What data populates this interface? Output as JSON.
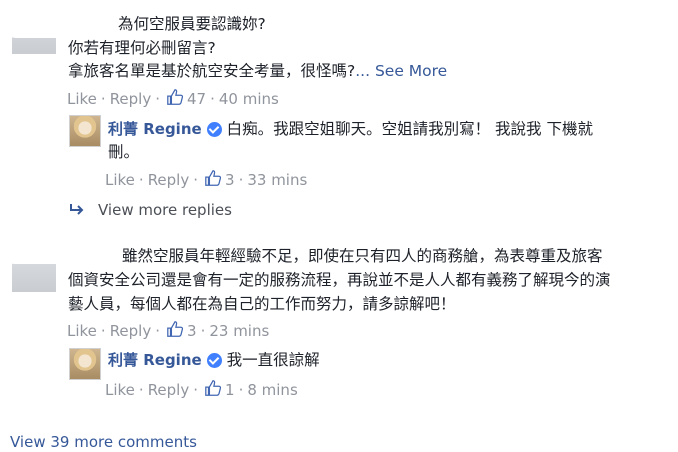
{
  "comment1": {
    "lines": [
      "為何空服員要認識妳?",
      "你若有理何必刪留言?",
      "拿旅客名單是基於航空安全考量，很怪嗎?"
    ],
    "see_more": "... See More",
    "like": "Like",
    "reply": "Reply",
    "likes": "47",
    "time": "40 mins"
  },
  "reply1": {
    "name": "利菁 Regine",
    "lines": [
      "白痴。我跟空姐聊天。空姐請我別寫！ 我說我 下機就",
      "刪。"
    ],
    "like": "Like",
    "reply": "Reply",
    "likes": "3",
    "time": "33 mins"
  },
  "view_more_replies": "View more replies",
  "comment2": {
    "lines": [
      "雖然空服員年輕經驗不足，即使在只有四人的商務艙，為表尊重及旅客",
      "個資安全公司還是會有一定的服務流程，再說並不是人人都有義務了解現今的演",
      "藝人員，每個人都在為自己的工作而努力，請多諒解吧！"
    ],
    "like": "Like",
    "reply": "Reply",
    "likes": "3",
    "time": "23 mins"
  },
  "reply2": {
    "name": "利菁 Regine",
    "lines": [
      "我一直很諒解"
    ],
    "like": "Like",
    "reply": "Reply",
    "likes": "1",
    "time": "8 mins"
  },
  "view_more_comments": "View 39 more comments",
  "colors": {
    "link": "#365899",
    "meta": "#90949c",
    "text": "#1d2129",
    "verified": "#4080ff"
  },
  "icons": {
    "like": "thumbs-up-icon",
    "reply_arrow": "reply-arrow-icon",
    "verified": "verified-badge-icon"
  }
}
